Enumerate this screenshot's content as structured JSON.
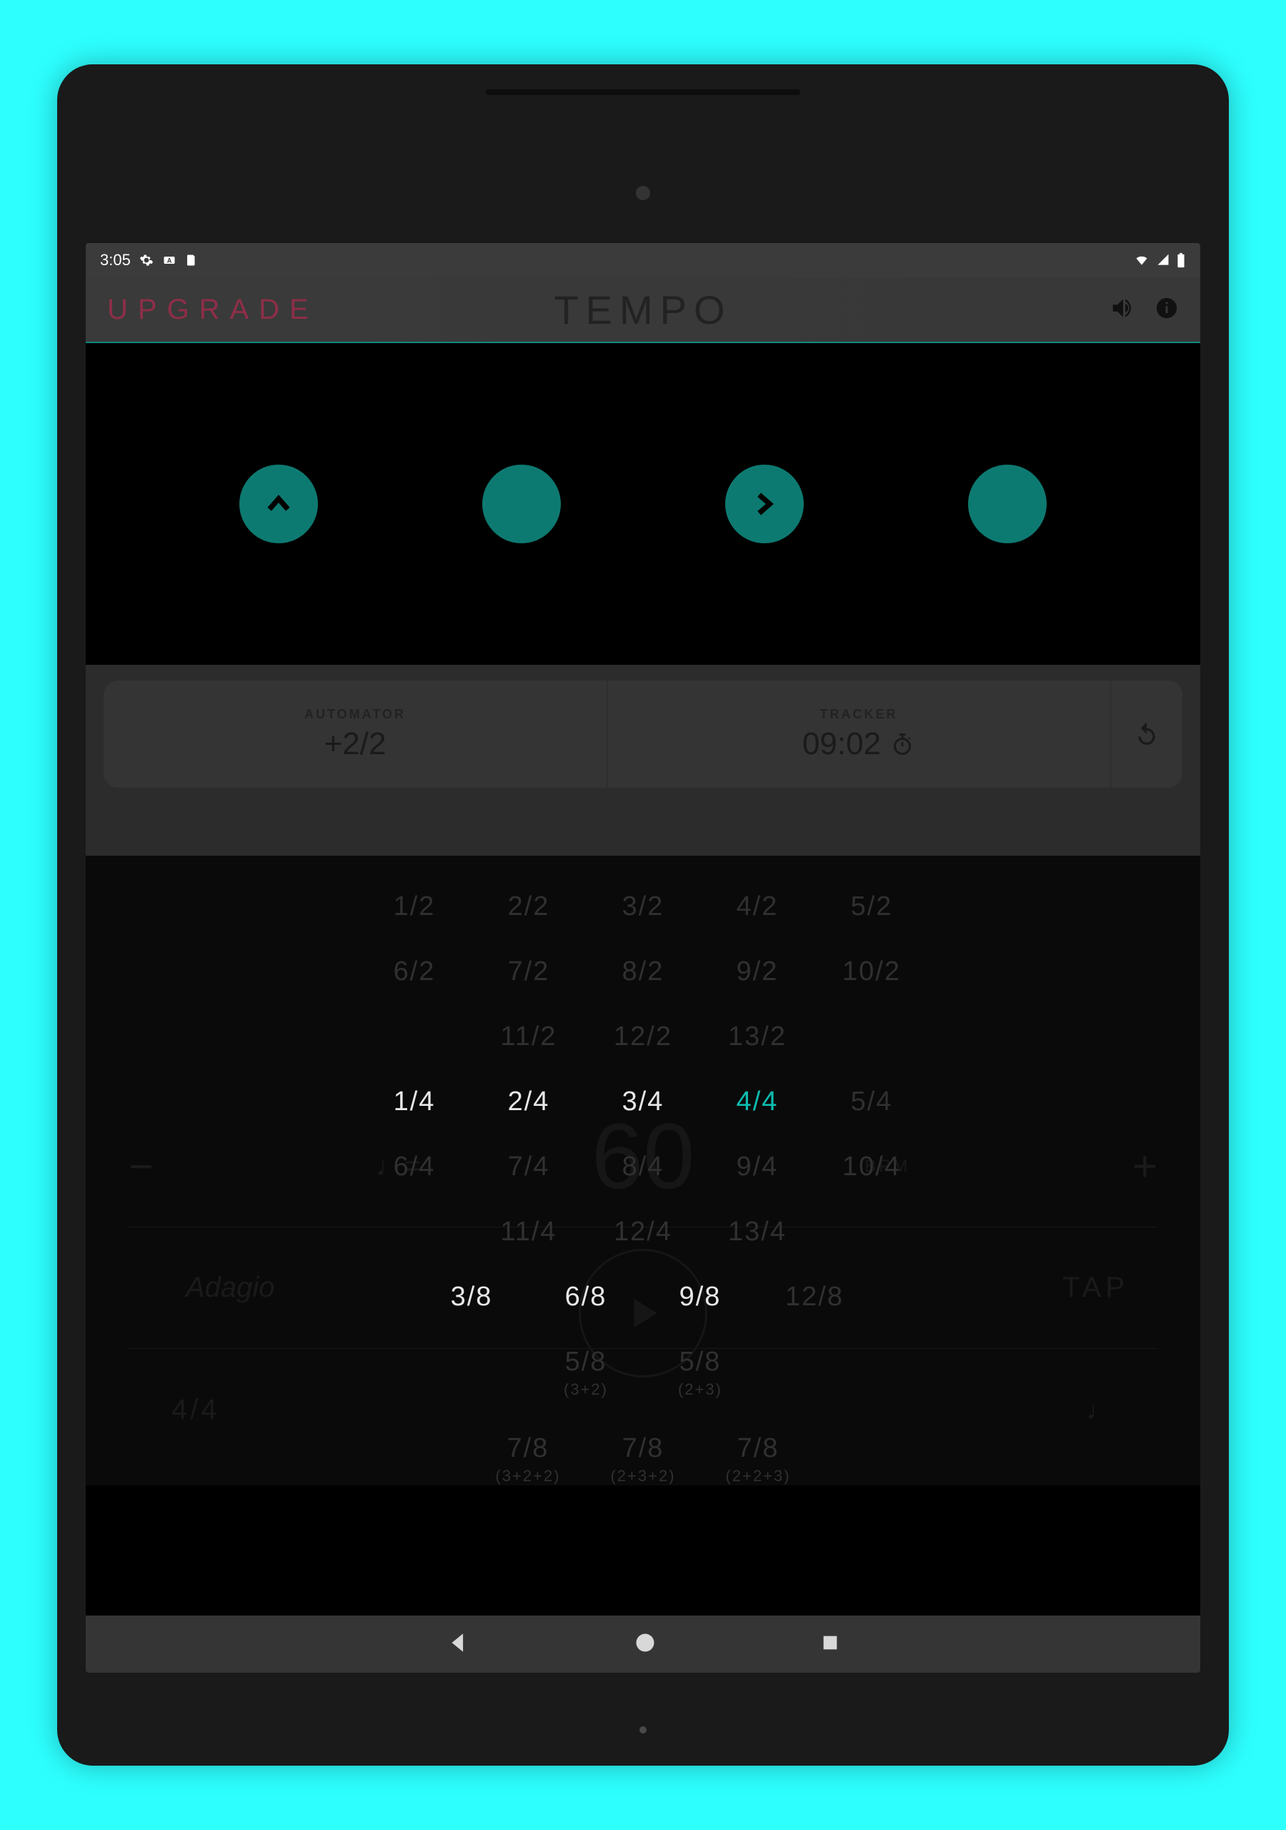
{
  "status": {
    "time": "3:05",
    "icons_left": [
      "gear",
      "keyboard",
      "sd-card"
    ],
    "icons_right": [
      "wifi",
      "signal",
      "battery"
    ]
  },
  "header": {
    "upgrade_label": "UPGRADE",
    "title": "TEMPO"
  },
  "beats": [
    {
      "glyph": "caret"
    },
    {
      "glyph": "none"
    },
    {
      "glyph": "chevron-right"
    },
    {
      "glyph": "none"
    }
  ],
  "panel": {
    "automator": {
      "label": "AUTOMATOR",
      "value": "+2/2"
    },
    "tracker": {
      "label": "TRACKER",
      "value": "09:02"
    }
  },
  "bpm": {
    "note_eq": "♩=",
    "value": "60",
    "unit": "BPM",
    "tempo_name": "Adagio",
    "tap": "TAP",
    "selected_sig": "4/4"
  },
  "sig_rows": [
    [
      {
        "t": "1/2"
      },
      {
        "t": "2/2"
      },
      {
        "t": "3/2"
      },
      {
        "t": "4/2"
      },
      {
        "t": "5/2"
      }
    ],
    [
      {
        "t": "6/2"
      },
      {
        "t": "7/2"
      },
      {
        "t": "8/2"
      },
      {
        "t": "9/2"
      },
      {
        "t": "10/2"
      }
    ],
    [
      {
        "t": "11/2"
      },
      {
        "t": "12/2"
      },
      {
        "t": "13/2"
      }
    ],
    [
      {
        "t": "1/4",
        "a": true
      },
      {
        "t": "2/4",
        "a": true
      },
      {
        "t": "3/4",
        "a": true
      },
      {
        "t": "4/4",
        "s": true
      },
      {
        "t": "5/4"
      }
    ],
    [
      {
        "t": "6/4"
      },
      {
        "t": "7/4"
      },
      {
        "t": "8/4"
      },
      {
        "t": "9/4"
      },
      {
        "t": "10/4"
      }
    ],
    [
      {
        "t": "11/4"
      },
      {
        "t": "12/4"
      },
      {
        "t": "13/4"
      }
    ],
    [
      {
        "t": "3/8",
        "a": true
      },
      {
        "t": "6/8",
        "a": true
      },
      {
        "t": "9/8",
        "a": true
      },
      {
        "t": "12/8"
      }
    ],
    [
      {
        "t": "5/8",
        "sub": "(3+2)"
      },
      {
        "t": "5/8",
        "sub": "(2+3)"
      }
    ],
    [
      {
        "t": "7/8",
        "sub": "(3+2+2)"
      },
      {
        "t": "7/8",
        "sub": "(2+3+2)"
      },
      {
        "t": "7/8",
        "sub": "(2+2+3)"
      }
    ]
  ]
}
